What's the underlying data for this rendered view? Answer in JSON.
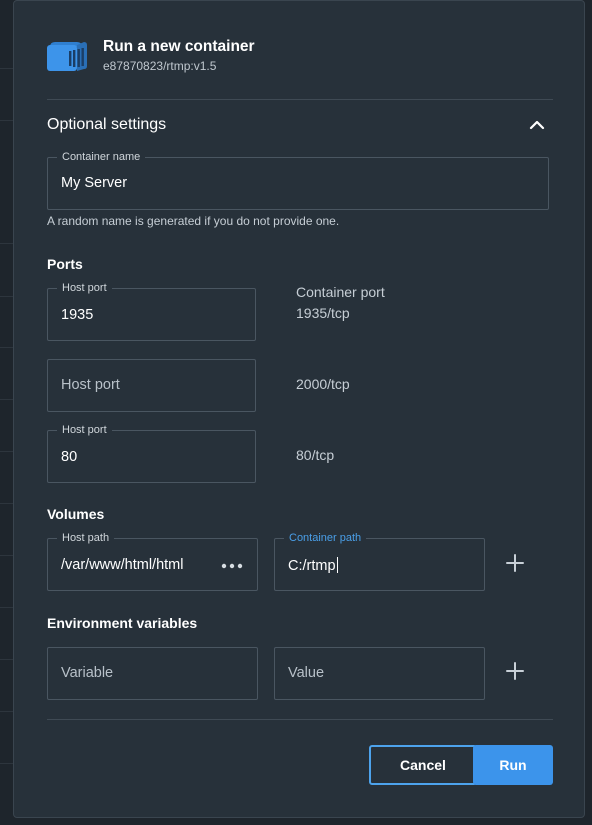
{
  "dialog": {
    "title": "Run a new container",
    "subtitle": "e87870823/rtmp:v1.5"
  },
  "optional_settings": {
    "title": "Optional settings",
    "container_name": {
      "label": "Container name",
      "value": "My Server"
    },
    "hint": "A random name is generated if you do not provide one."
  },
  "ports": {
    "title": "Ports",
    "container_port_header": "Container port",
    "rows": [
      {
        "host_label": "Host port",
        "host_value": "1935",
        "container_port": "1935/tcp"
      },
      {
        "host_placeholder": "Host port",
        "container_port": "2000/tcp"
      },
      {
        "host_label": "Host port",
        "host_value": "80",
        "container_port": "80/tcp"
      }
    ]
  },
  "volumes": {
    "title": "Volumes",
    "host_path_label": "Host path",
    "host_path_value": "/var/www/html/html",
    "container_path_label": "Container path",
    "container_path_value": "C:/rtmp"
  },
  "env": {
    "title": "Environment variables",
    "variable_placeholder": "Variable",
    "value_placeholder": "Value"
  },
  "actions": {
    "cancel_label": "Cancel",
    "run_label": "Run"
  },
  "colors": {
    "accent": "#3c94eb",
    "dialog_bg": "#27313a"
  }
}
